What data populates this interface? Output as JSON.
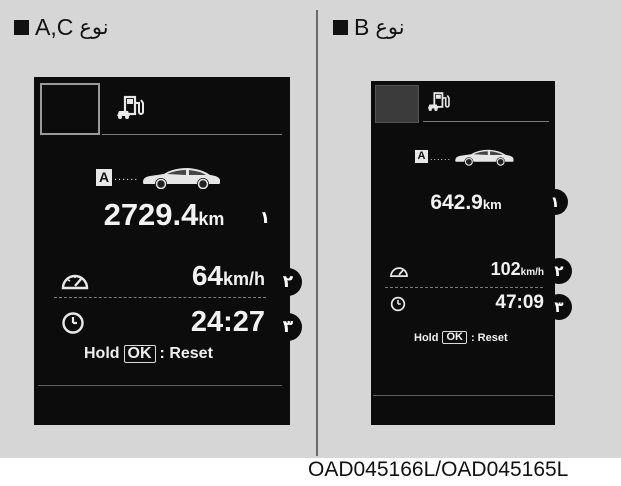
{
  "panels": {
    "left": {
      "type_prefix": "A,C",
      "type_word": "نوع",
      "distance_value": "2729.4",
      "distance_unit": "km",
      "speed_value": "64",
      "speed_unit": "km/h",
      "time_value": "24:27",
      "badge_letter": "A",
      "dots": "......",
      "reset_hold": "Hold",
      "reset_ok": "OK",
      "reset_text": ": Reset",
      "markers": [
        "١",
        "٢",
        "٣"
      ]
    },
    "right": {
      "type_prefix": "B",
      "type_word": "نوع",
      "distance_value": "642.9",
      "distance_unit": "km",
      "speed_value": "102",
      "speed_unit": "km/h",
      "time_value": "47:09",
      "badge_letter": "A",
      "dots": "......",
      "reset_hold": "Hold",
      "reset_ok": "OK",
      "reset_text": ": Reset",
      "markers": [
        "١",
        "٢",
        "٣"
      ]
    }
  },
  "caption": "OAD045166L/OAD045165L",
  "colors": {
    "background": "#d6d6d6",
    "screen": "#0c0c0c",
    "text": "#f2f2f2"
  }
}
